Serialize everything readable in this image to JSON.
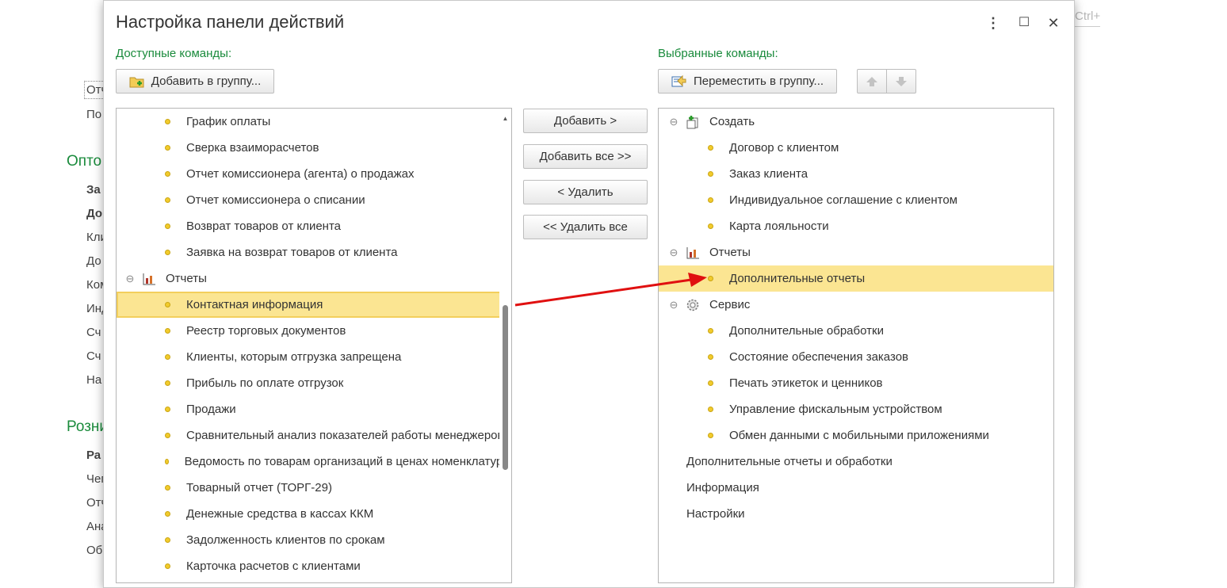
{
  "background": {
    "fragments": [
      "Отч",
      "По",
      "Опто",
      "За",
      "До",
      "Кли",
      "До",
      "Ком",
      "Инд",
      "Сч",
      "Сч",
      "На",
      "Розни",
      "Ра",
      "Чег",
      "Отч",
      "Ана",
      "Об"
    ],
    "ctrl_hint": "Ctrl+"
  },
  "dialog": {
    "title": "Настройка панели действий",
    "menu_glyph": "⋮",
    "maximize_glyph": "☐",
    "close_glyph": "✕"
  },
  "left": {
    "label": "Доступные команды:",
    "add_group_button": "Добавить в группу...",
    "rows": [
      {
        "text": "График оплаты",
        "type": "item"
      },
      {
        "text": "Сверка взаиморасчетов",
        "type": "item"
      },
      {
        "text": "Отчет комиссионера (агента) о продажах",
        "type": "item"
      },
      {
        "text": "Отчет комиссионера о списании",
        "type": "item"
      },
      {
        "text": "Возврат товаров от клиента",
        "type": "item"
      },
      {
        "text": "Заявка на возврат товаров от клиента",
        "type": "item"
      },
      {
        "text": "Отчеты",
        "type": "group",
        "icon": "chart-icon"
      },
      {
        "text": "Контактная информация",
        "type": "item",
        "selected": true
      },
      {
        "text": "Реестр торговых документов",
        "type": "item"
      },
      {
        "text": "Клиенты, которым отгрузка запрещена",
        "type": "item"
      },
      {
        "text": "Прибыль по оплате отгрузок",
        "type": "item"
      },
      {
        "text": "Продажи",
        "type": "item"
      },
      {
        "text": "Сравнительный анализ показателей работы менеджеров",
        "type": "item"
      },
      {
        "text": "Ведомость по товарам организаций в ценах номенклатуры",
        "type": "item"
      },
      {
        "text": "Товарный отчет (ТОРГ-29)",
        "type": "item"
      },
      {
        "text": "Денежные средства в кассах ККМ",
        "type": "item"
      },
      {
        "text": "Задолженность клиентов по срокам",
        "type": "item"
      },
      {
        "text": "Карточка расчетов с клиентами",
        "type": "item"
      }
    ]
  },
  "middle": {
    "add": "Добавить >",
    "add_all": "Добавить все >>",
    "remove": "< Удалить",
    "remove_all": "<< Удалить все"
  },
  "right": {
    "label": "Выбранные команды:",
    "move_group_button": "Переместить в группу...",
    "rows": [
      {
        "text": "Создать",
        "type": "group",
        "icon": "create-icon"
      },
      {
        "text": "Договор с клиентом",
        "type": "item"
      },
      {
        "text": "Заказ клиента",
        "type": "item"
      },
      {
        "text": "Индивидуальное соглашение с клиентом",
        "type": "item"
      },
      {
        "text": "Карта лояльности",
        "type": "item"
      },
      {
        "text": "Отчеты",
        "type": "group",
        "icon": "chart-icon"
      },
      {
        "text": "Дополнительные отчеты",
        "type": "item",
        "selected": true
      },
      {
        "text": "Сервис",
        "type": "group",
        "icon": "gear-icon"
      },
      {
        "text": "Дополнительные обработки",
        "type": "item"
      },
      {
        "text": "Состояние обеспечения заказов",
        "type": "item"
      },
      {
        "text": "Печать этикеток и ценников",
        "type": "item"
      },
      {
        "text": "Управление фискальным устройством",
        "type": "item"
      },
      {
        "text": "Обмен данными с мобильными приложениями",
        "type": "item"
      },
      {
        "text": "Дополнительные отчеты и обработки",
        "type": "plain"
      },
      {
        "text": "Информация",
        "type": "plain"
      },
      {
        "text": "Настройки",
        "type": "plain"
      }
    ]
  },
  "colors": {
    "accent_green": "#1a8b3c",
    "selection": "#fbe592",
    "arrow": "#e01010"
  }
}
